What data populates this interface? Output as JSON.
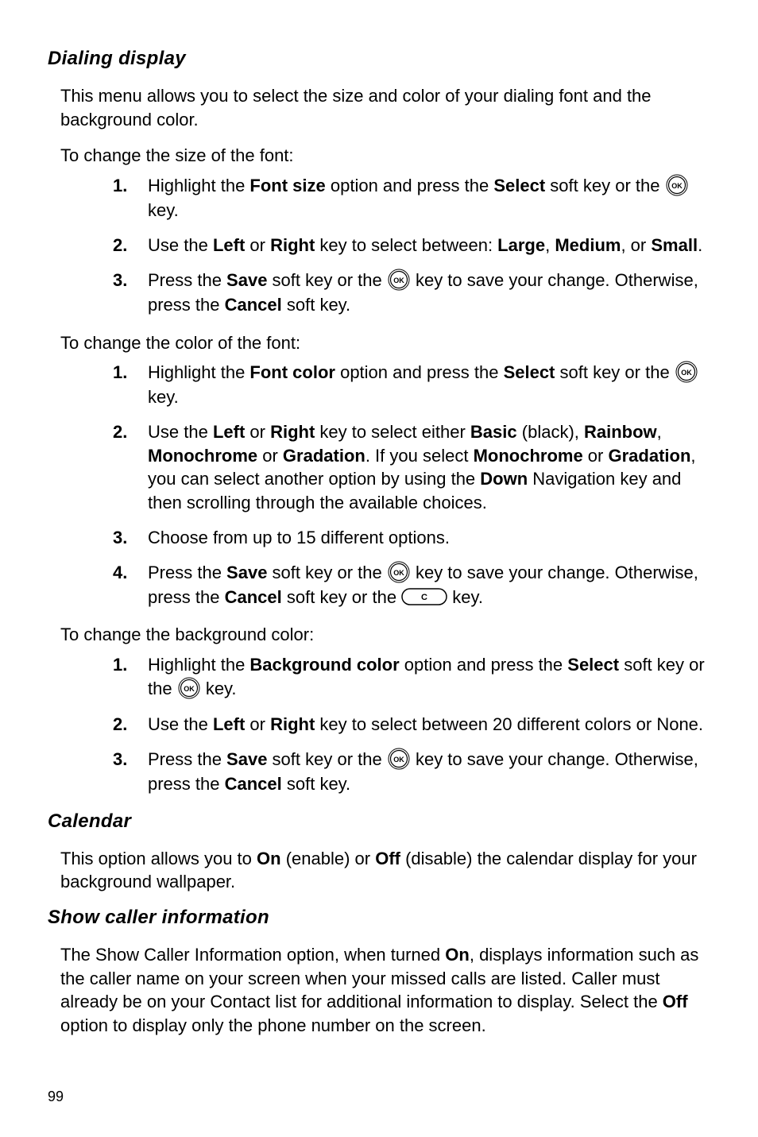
{
  "section1": {
    "heading": "Dialing display",
    "intro": "This menu allows you to select the size and color of your dialing font and the background color.",
    "lead_a": "To change the size of the font:",
    "list_a": {
      "n1": "1.",
      "i1a": "Highlight the ",
      "i1b": "Font size",
      "i1c": " option and press the ",
      "i1d": "Select",
      "i1e": " soft key or the ",
      "i1f": " key.",
      "n2": "2.",
      "i2a": "Use the ",
      "i2b": "Left",
      "i2c": " or ",
      "i2d": "Right",
      "i2e": " key to select between: ",
      "i2f": "Large",
      "i2g": ", ",
      "i2h": "Medium",
      "i2i": ", or ",
      "i2j": "Small",
      "i2k": ".",
      "n3": "3.",
      "i3a": "Press the ",
      "i3b": "Save",
      "i3c": " soft key or the ",
      "i3d": " key to save your change. Otherwise, press the ",
      "i3e": "Cancel",
      "i3f": " soft key."
    },
    "lead_b": "To change the color of the font:",
    "list_b": {
      "n1": "1.",
      "i1a": "Highlight the ",
      "i1b": "Font color",
      "i1c": " option and press the ",
      "i1d": "Select",
      "i1e": " soft key or the ",
      "i1f": " key.",
      "n2": "2.",
      "i2a": "Use the ",
      "i2b": "Left",
      "i2c": " or ",
      "i2d": "Right",
      "i2e": " key to select either ",
      "i2f": "Basic",
      "i2g": " (black), ",
      "i2h": "Rainbow",
      "i2i": ", ",
      "i2j": "Monochrome",
      "i2k": " or ",
      "i2l": "Gradation",
      "i2m": ". If you select ",
      "i2n": "Monochrome",
      "i2o": " or ",
      "i2p": "Gradation",
      "i2q": ", you can select another option by using the ",
      "i2r": "Down",
      "i2s": " Navigation key and then scrolling through the available choices.",
      "n3": "3.",
      "i3a": "Choose from up to 15 different options.",
      "n4": "4.",
      "i4a": "Press the ",
      "i4b": "Save",
      "i4c": " soft key or the ",
      "i4d": " key to save your change. Otherwise, press the ",
      "i4e": "Cancel",
      "i4f": " soft key or the ",
      "i4g": " key."
    },
    "lead_c": "To change the background color:",
    "list_c": {
      "n1": "1.",
      "i1a": "Highlight the ",
      "i1b": "Background color",
      "i1c": " option and press the ",
      "i1d": "Select",
      "i1e": " soft key or the ",
      "i1f": " key.",
      "n2": "2.",
      "i2a": "Use the ",
      "i2b": "Left",
      "i2c": " or ",
      "i2d": "Right",
      "i2e": " key to select between 20 different colors or None.",
      "n3": "3.",
      "i3a": "Press the ",
      "i3b": "Save",
      "i3c": " soft key or the ",
      "i3d": " key to save your change. Otherwise, press the ",
      "i3e": "Cancel",
      "i3f": " soft key."
    }
  },
  "section2": {
    "heading": "Calendar",
    "p_a": "This option allows you to ",
    "p_b": "On",
    "p_c": " (enable) or ",
    "p_d": "Off",
    "p_e": " (disable) the calendar display for your background wallpaper."
  },
  "section3": {
    "heading": "Show caller information",
    "p_a": "The Show Caller Information option, when turned ",
    "p_b": "On",
    "p_c": ", displays information such as the caller name on your screen when your missed calls are listed. Caller must already be on your Contact list for additional information to display. Select the ",
    "p_d": "Off",
    "p_e": " option to display only the phone number on the screen."
  },
  "page_number": "99"
}
